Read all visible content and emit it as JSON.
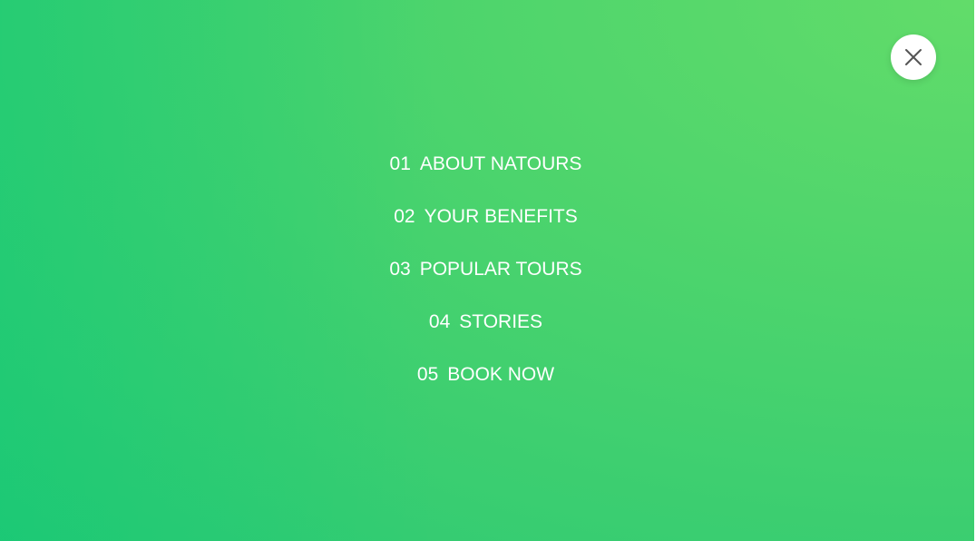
{
  "close_button": {
    "icon": "close-icon"
  },
  "navigation": {
    "items": [
      {
        "number": "01",
        "label": "ABOUT NATOURS"
      },
      {
        "number": "02",
        "label": "YOUR BENEFITS"
      },
      {
        "number": "03",
        "label": "POPULAR TOURS"
      },
      {
        "number": "04",
        "label": "STORIES"
      },
      {
        "number": "05",
        "label": "BOOK NOW"
      }
    ]
  },
  "colors": {
    "background_start": "#2bc974",
    "background_end": "#62dc6a",
    "text": "#ffffff",
    "close_button_bg": "#ffffff",
    "close_icon": "#555555"
  }
}
